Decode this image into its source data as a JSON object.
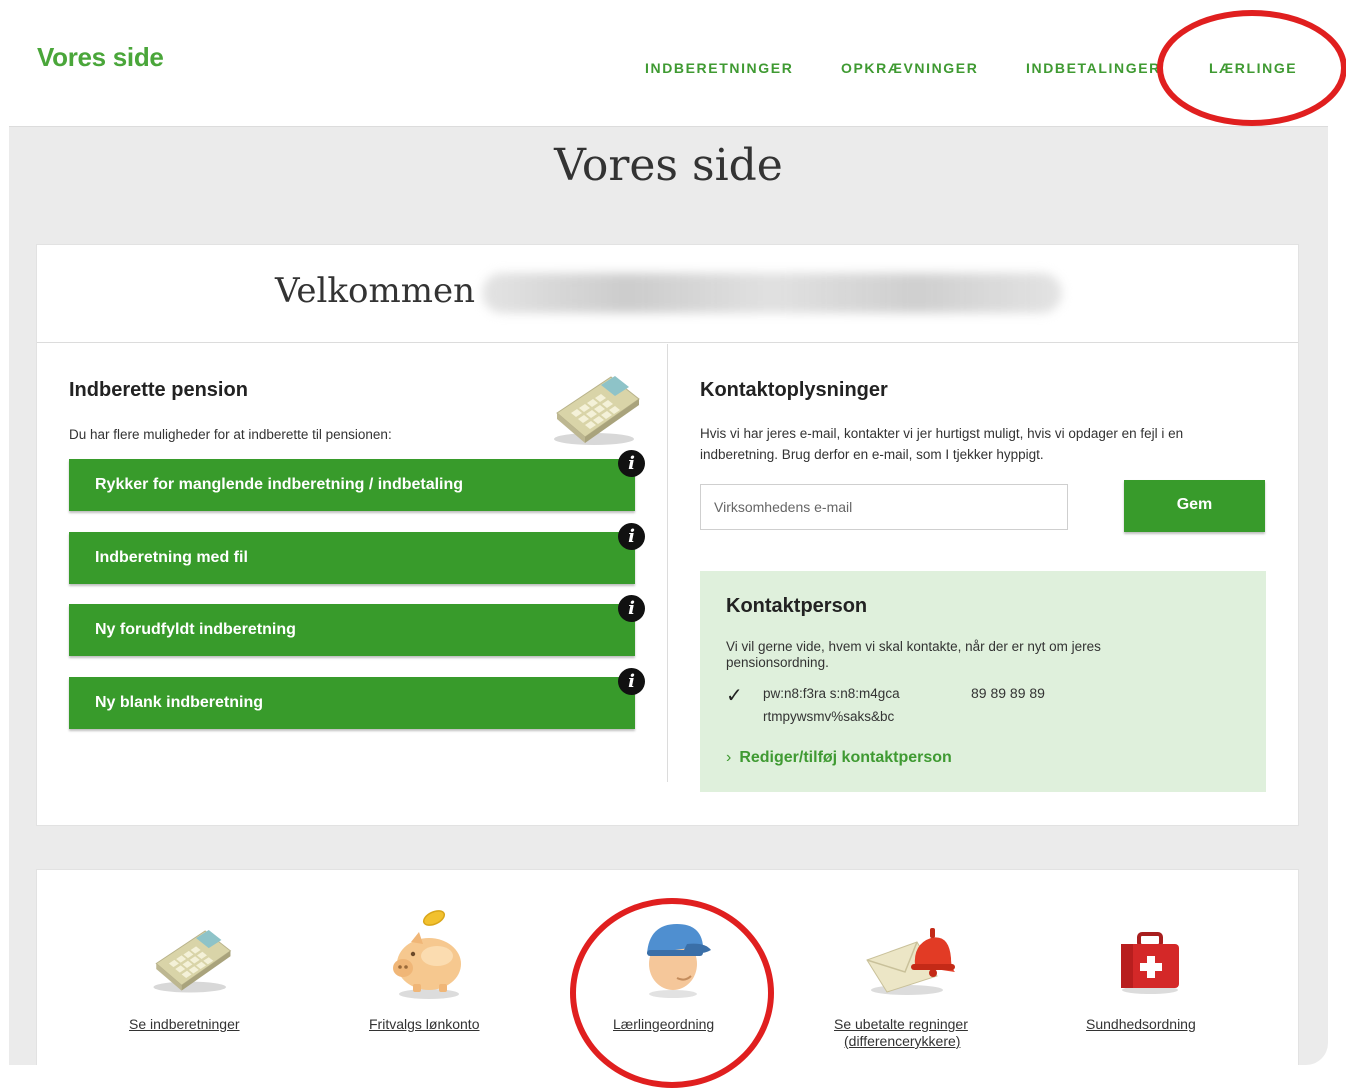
{
  "header": {
    "logo": "Vores side",
    "nav": [
      "INDBERETNINGER",
      "OPKRÆVNINGER",
      "INDBETALINGER",
      "LÆRLINGE"
    ]
  },
  "page": {
    "title": "Vores side",
    "welcome": "Velkommen"
  },
  "pension": {
    "title": "Indberette pension",
    "intro": "Du har flere muligheder for at indberette til pensionen:",
    "buttons": [
      "Rykker for manglende indberetning / indbetaling",
      "Indberetning med fil",
      "Ny forudfyldt indberetning",
      "Ny blank indberetning"
    ],
    "info_glyph": "i"
  },
  "contact": {
    "title": "Kontaktoplysninger",
    "text_line1": "Hvis vi har jeres e-mail, kontakter vi jer hurtigst muligt, hvis vi opdager en fejl i en",
    "text_line2": "indberetning. Brug derfor en e-mail, som I tjekker hyppigt.",
    "email_placeholder": "Virksomhedens e-mail",
    "save_label": "Gem"
  },
  "contact_person": {
    "title": "Kontaktperson",
    "text_line1": "Vi vil gerne vide, hvem vi skal kontakte, når der er nyt om jeres",
    "text_line2": "pensionsordning.",
    "name": "pw:n8:f3ra s:n8:m4gca",
    "phone": "89 89 89 89",
    "email": "rtmpywsmv%saks&bc",
    "edit_link": "Rediger/tilføj kontaktperson"
  },
  "cards": [
    {
      "label": "Se indberetninger",
      "icon": "calculator-icon"
    },
    {
      "label": "Fritvalgs lønkonto",
      "icon": "piggy-bank-icon"
    },
    {
      "label": "Lærlingeordning",
      "icon": "apprentice-cap-icon"
    },
    {
      "label_line1": "Se ubetalte regninger",
      "label_line2": "(differencerykkere)",
      "icon": "envelope-bell-icon"
    },
    {
      "label": "Sundhedsordning",
      "icon": "first-aid-kit-icon"
    }
  ],
  "colors": {
    "brand_green": "#389b2b",
    "link_green": "#3f9a32",
    "highlight_ring": "#e01f1f",
    "contact_box": "#dff0dc"
  }
}
